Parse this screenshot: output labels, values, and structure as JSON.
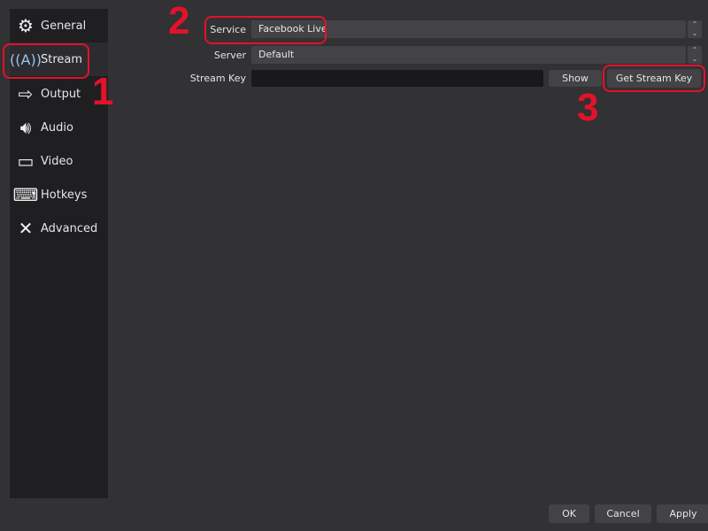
{
  "sidebar": {
    "items": [
      {
        "label": "General",
        "icon": "gear-icon"
      },
      {
        "label": "Stream",
        "icon": "broadcast-antenna-icon",
        "selected": true
      },
      {
        "label": "Output",
        "icon": "output-monitor-icon"
      },
      {
        "label": "Audio",
        "icon": "speaker-icon"
      },
      {
        "label": "Video",
        "icon": "monitor-icon"
      },
      {
        "label": "Hotkeys",
        "icon": "keyboard-icon"
      },
      {
        "label": "Advanced",
        "icon": "tools-icon"
      }
    ]
  },
  "stream": {
    "service_label": "Service",
    "service_value": "Facebook Live",
    "server_label": "Server",
    "server_value": "Default",
    "key_label": "Stream Key",
    "key_value": "",
    "show_label": "Show",
    "get_key_label": "Get Stream Key"
  },
  "footer": {
    "ok": "OK",
    "cancel": "Cancel",
    "apply": "Apply"
  },
  "annotations": {
    "n1": "1",
    "n2": "2",
    "n3": "3",
    "color": "#e3122b"
  }
}
